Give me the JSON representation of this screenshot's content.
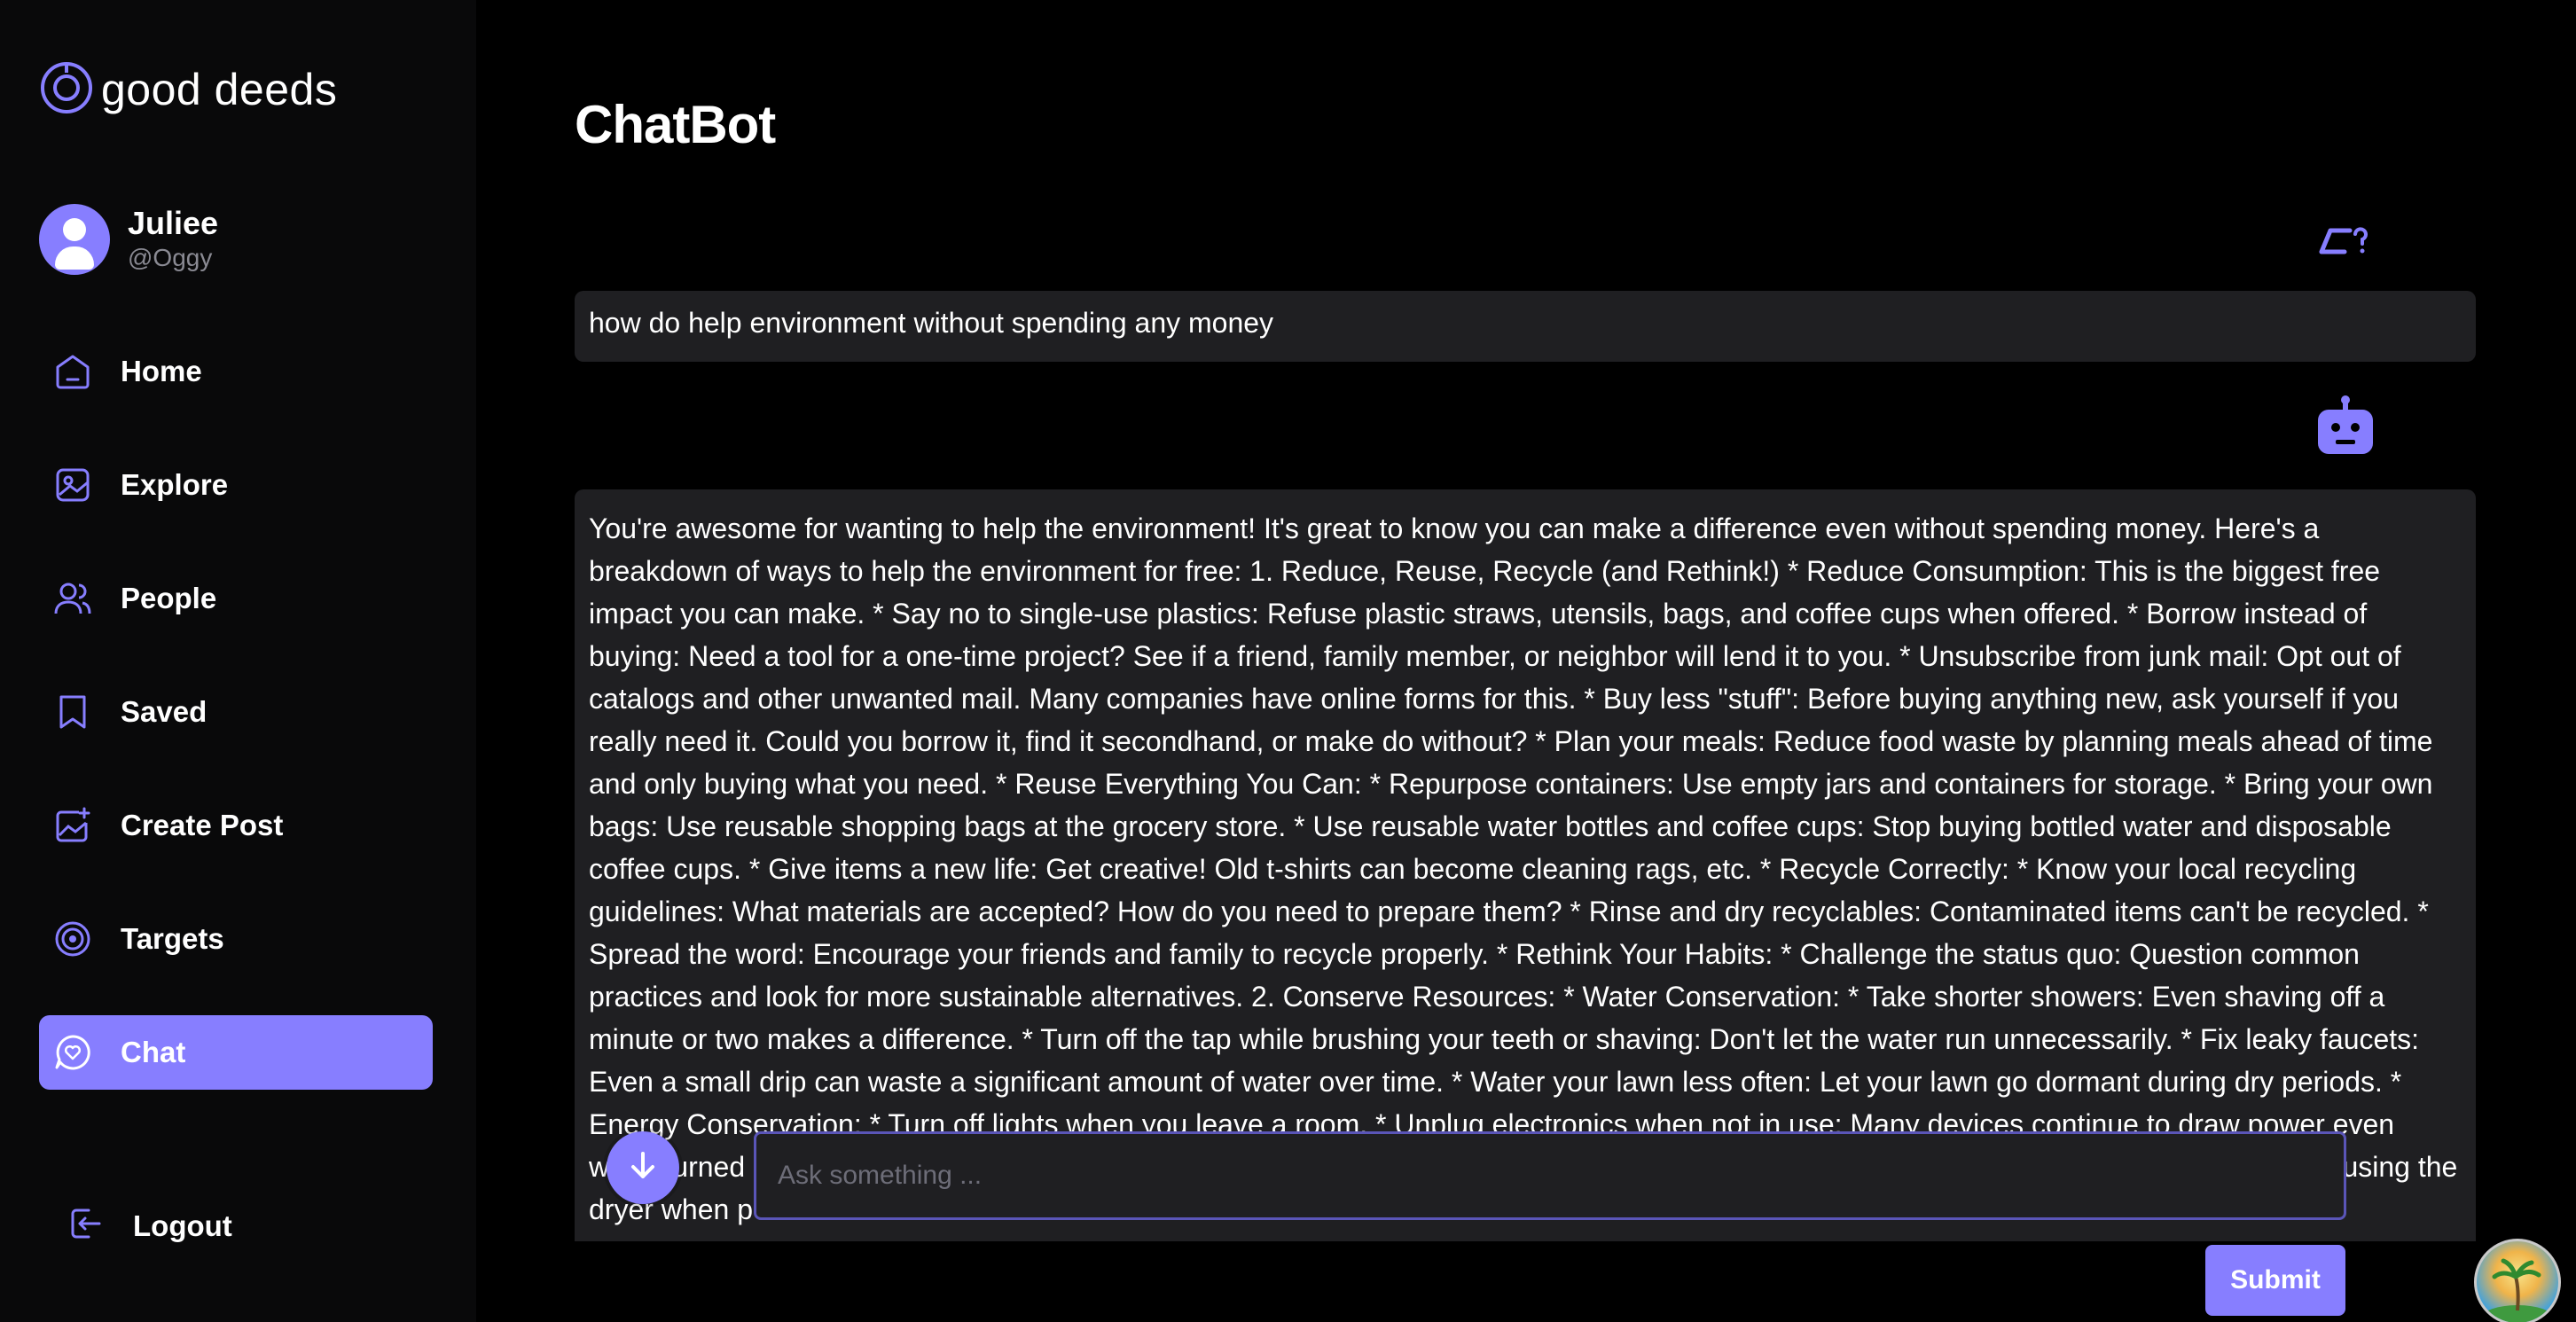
{
  "app": {
    "name": "good deeds"
  },
  "profile": {
    "name": "Juliee",
    "handle": "@Oggy"
  },
  "nav": {
    "items": [
      {
        "label": "Home",
        "icon": "home-icon"
      },
      {
        "label": "Explore",
        "icon": "explore-icon"
      },
      {
        "label": "People",
        "icon": "people-icon"
      },
      {
        "label": "Saved",
        "icon": "bookmark-icon"
      },
      {
        "label": "Create Post",
        "icon": "create-post-icon"
      },
      {
        "label": "Targets",
        "icon": "target-icon"
      },
      {
        "label": "Chat",
        "icon": "chat-icon",
        "active": true
      }
    ],
    "logout": "Logout"
  },
  "page": {
    "title": "ChatBot"
  },
  "chat": {
    "user_message": "how do help environment without spending any money",
    "bot_message": "You're awesome for wanting to help the environment! It's great to know you can make a difference even without spending money. Here's a breakdown of ways to help the environment for free: 1. Reduce, Reuse, Recycle (and Rethink!) * Reduce Consumption: This is the biggest free impact you can make. * Say no to single-use plastics: Refuse plastic straws, utensils, bags, and coffee cups when offered. * Borrow instead of buying: Need a tool for a one-time project? See if a friend, family member, or neighbor will lend it to you. * Unsubscribe from junk mail: Opt out of catalogs and other unwanted mail. Many companies have online forms for this. * Buy less \"stuff\": Before buying anything new, ask yourself if you really need it. Could you borrow it, find it secondhand, or make do without? * Plan your meals: Reduce food waste by planning meals ahead of time and only buying what you need. * Reuse Everything You Can: * Repurpose containers: Use empty jars and containers for storage. * Bring your own bags: Use reusable shopping bags at the grocery store. * Use reusable water bottles and coffee cups: Stop buying bottled water and disposable coffee cups. * Give items a new life: Get creative! Old t-shirts can become cleaning rags, etc. * Recycle Correctly: * Know your local recycling guidelines: What materials are accepted? How do you need to prepare them? * Rinse and dry recyclables: Contaminated items can't be recycled. * Spread the word: Encourage your friends and family to recycle properly. * Rethink Your Habits: * Challenge the status quo: Question common practices and look for more sustainable alternatives. 2. Conserve Resources: * Water Conservation: * Take shorter showers: Even shaving off a minute or two makes a difference. * Turn off the tap while brushing your teeth or shaving: Don't let the water run unnecessarily. * Fix leaky faucets: Even a small drip can waste a significant amount of water over time. * Water your lawn less often: Let your lawn go dormant during dry periods. * Energy Conservation: * Turn off lights when you leave a room. * Unplug electronics when not in use: Many devices continue to draw power even when turned off. * Use natural light: Open curtains and blinds during the day to reduce the need for artificial light. * Air dry clothes instead of using the dryer when possible.",
    "input_placeholder": "Ask something ...",
    "submit_label": "Submit"
  },
  "colors": {
    "accent": "#877eff",
    "sidebar_bg": "#09090a",
    "message_bg": "#1f1f22"
  }
}
